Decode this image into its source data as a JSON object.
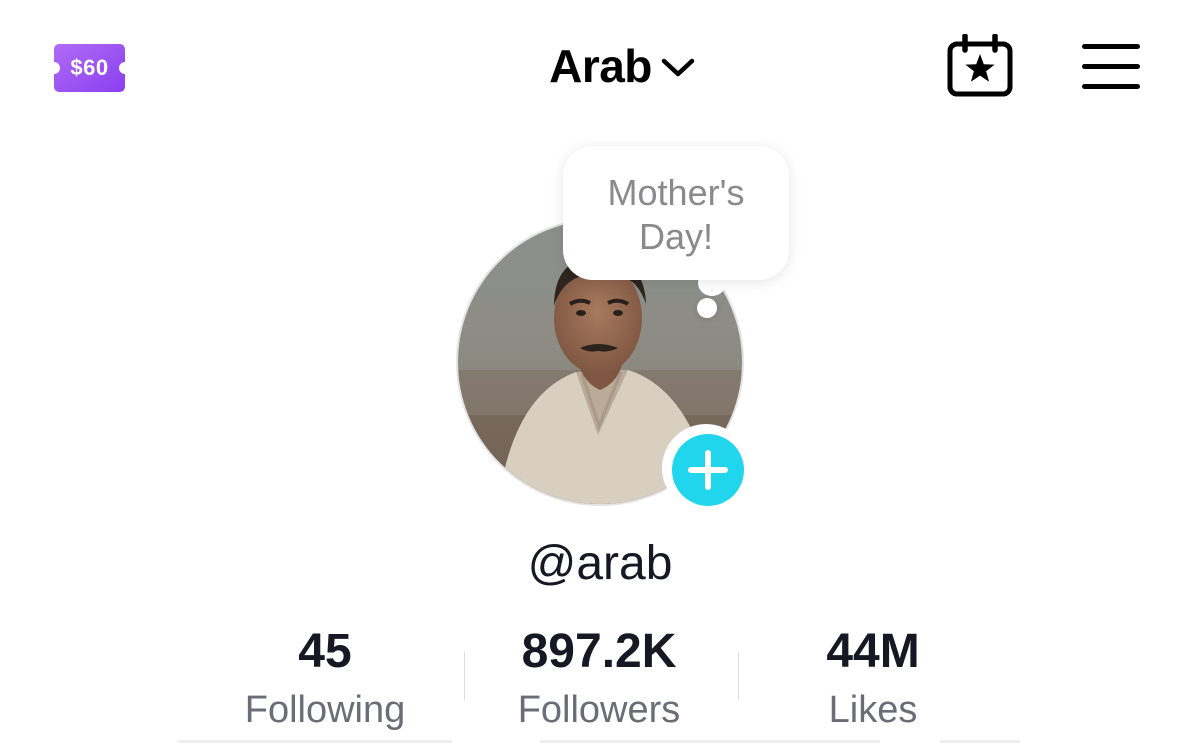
{
  "header": {
    "coupon_label": "$60",
    "account_name": "Arab"
  },
  "icons": {
    "coupon": "coupon-ticket-icon",
    "chevron": "chevron-down-icon",
    "calendar": "calendar-star-icon",
    "menu": "hamburger-menu-icon",
    "add": "plus-icon"
  },
  "profile": {
    "note_text": "Mother's Day!",
    "username": "@arab"
  },
  "stats": [
    {
      "value": "45",
      "label": "Following"
    },
    {
      "value": "897.2K",
      "label": "Followers"
    },
    {
      "value": "44M",
      "label": "Likes"
    }
  ],
  "colors": {
    "coupon_purple": "#9b59f0",
    "add_button_cyan": "#20d5ec",
    "text_primary": "#161823",
    "text_secondary": "#6b6d76"
  }
}
